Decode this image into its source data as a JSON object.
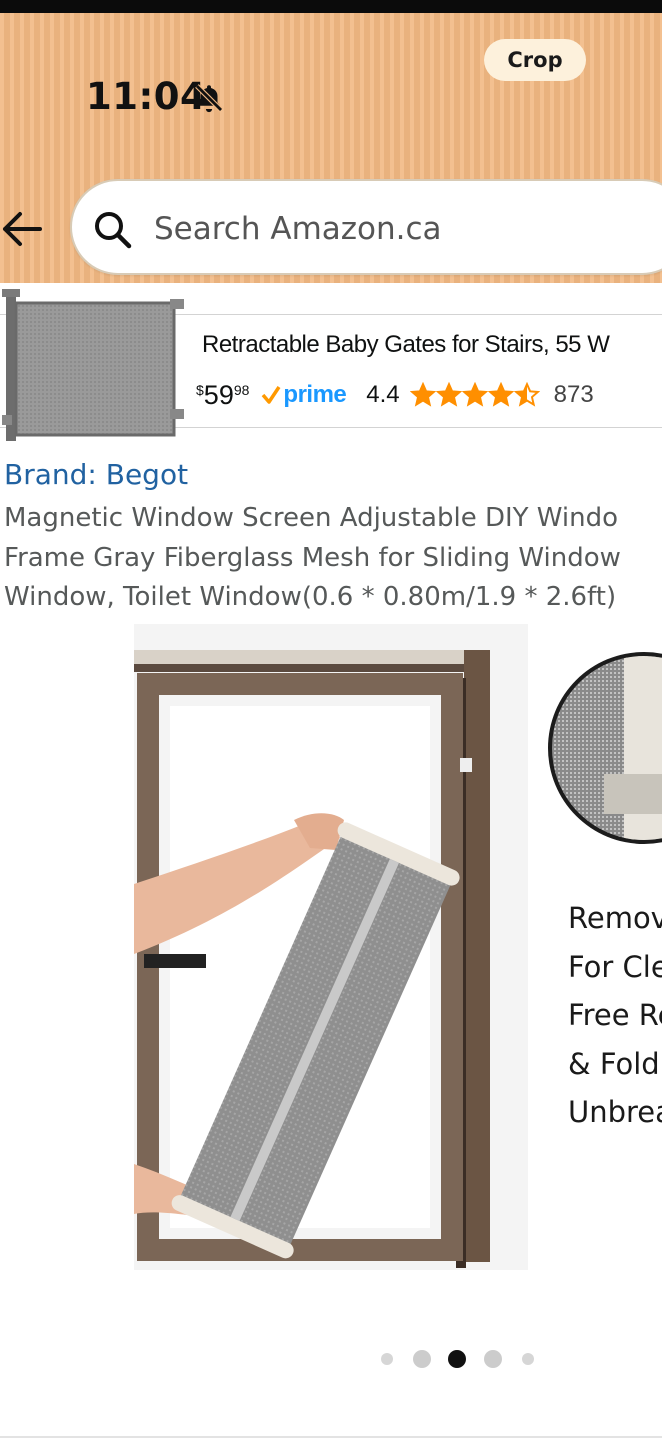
{
  "status_bar": {
    "time": "11:04",
    "crop_label": "Crop",
    "icons": [
      "bell-off-icon"
    ]
  },
  "search": {
    "placeholder": "Search Amazon.ca",
    "icons": [
      "back-arrow-icon",
      "search-icon"
    ]
  },
  "sponsored_banner": {
    "title": "Retractable Baby Gates for Stairs, 55 W",
    "price_symbol": "$",
    "price_whole": "59",
    "price_fraction": "98",
    "prime_label": "prime",
    "rating": "4.4",
    "stars_filled": 4.4,
    "review_count": "873",
    "colors": {
      "prime": "#1a98ff",
      "stars": "#ff8f00"
    }
  },
  "product": {
    "brand_link": "Brand: Begot",
    "title_lines": [
      "Magnetic Window Screen Adjustable DIY Windo",
      "Frame Gray Fiberglass Mesh for Sliding Window",
      "Window, Toilet Window(0.6 * 0.80m/1.9 * 2.6ft)"
    ],
    "image_caption_lines": [
      "Remov",
      "For Cle",
      "Free Re",
      "& Fold",
      "Unbrea"
    ]
  },
  "gallery": {
    "total_images": 5,
    "active_index": 2
  },
  "colors": {
    "header_bg": "#f2b983",
    "link": "#2162a1",
    "title_text": "#565959"
  }
}
